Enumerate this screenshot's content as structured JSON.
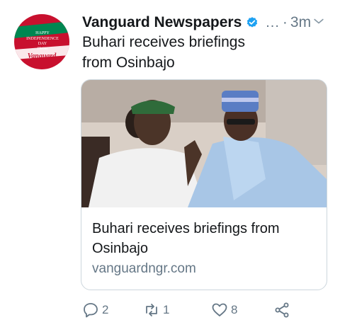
{
  "tweet": {
    "author_name": "Vanguard Newspapers",
    "verified": true,
    "more_dots": "...",
    "separator": "·",
    "time": "3m",
    "text": "Buhari receives briefings from Osinbajo",
    "avatar": {
      "line1": "HAPPY",
      "line2": "INDEPENDENCE",
      "line3": "DAY",
      "line4": "FROM",
      "brand": "Vanguard"
    }
  },
  "card": {
    "title": "Buhari receives briefings from Osinbajo",
    "domain": "vanguardngr.com"
  },
  "actions": {
    "reply_count": "2",
    "retweet_count": "1",
    "like_count": "8"
  },
  "colors": {
    "accent": "#1da1f2",
    "muted": "#657786",
    "text": "#14171a",
    "border": "#ccd6dd"
  },
  "icons": [
    "verified-badge-icon",
    "chevron-down-icon",
    "reply-icon",
    "retweet-icon",
    "like-icon",
    "share-icon"
  ]
}
